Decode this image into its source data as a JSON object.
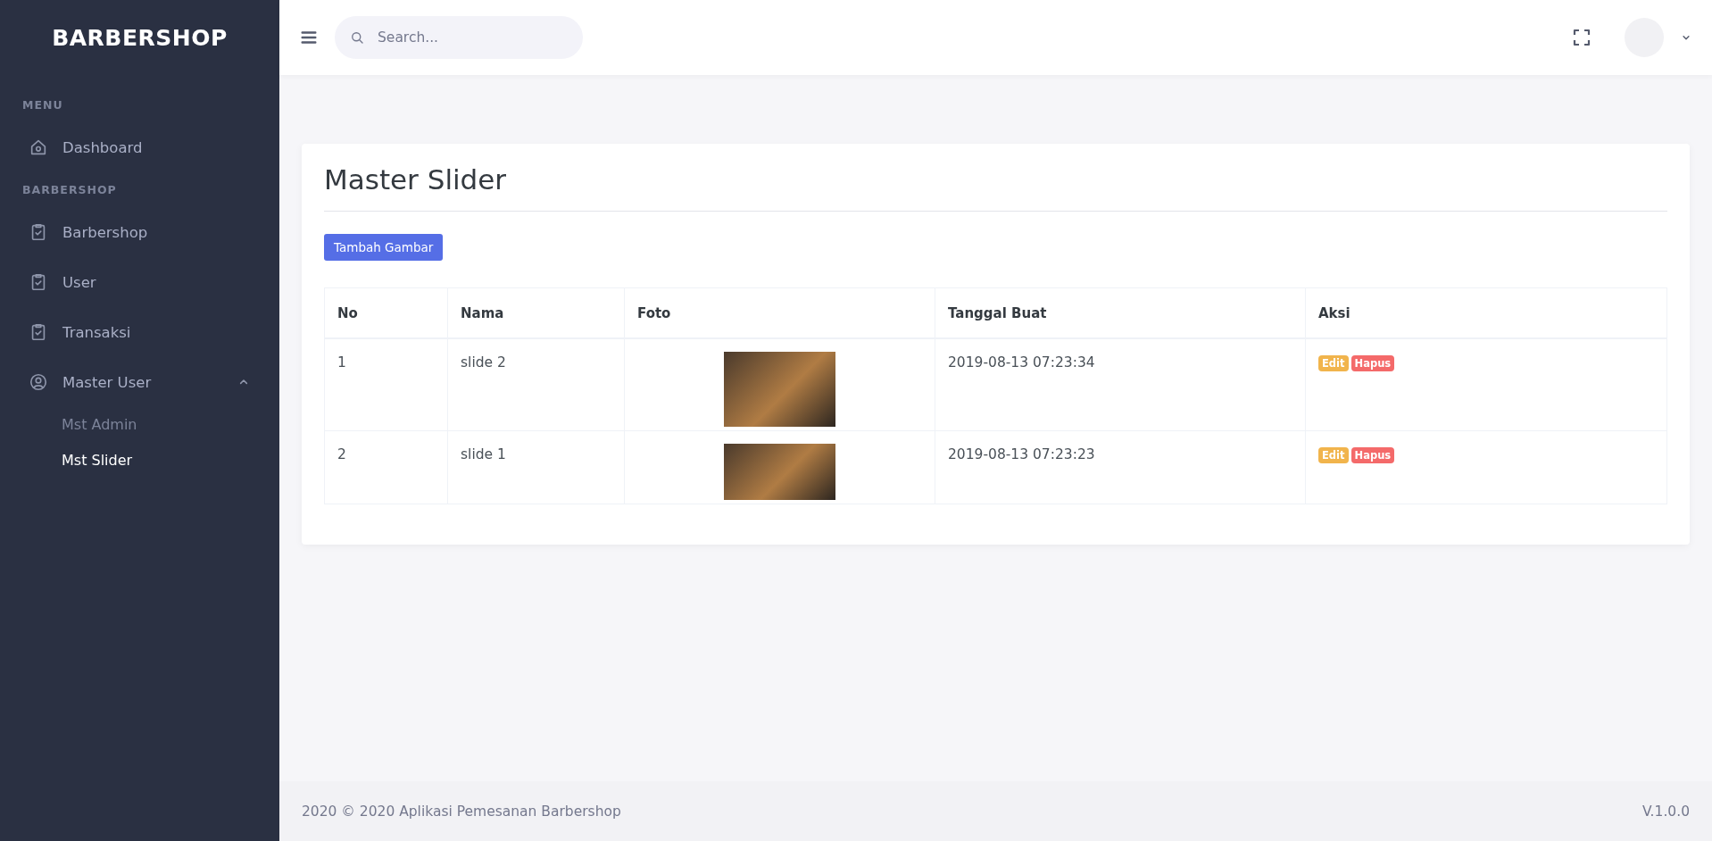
{
  "sidebar": {
    "brand": "BARBERSHOP",
    "sections": [
      {
        "heading": "MENU",
        "items": [
          {
            "kind": "home",
            "label": "Dashboard"
          }
        ]
      },
      {
        "heading": "BARBERSHOP",
        "items": [
          {
            "kind": "clipboard",
            "label": "Barbershop"
          },
          {
            "kind": "clipboard",
            "label": "User"
          },
          {
            "kind": "clipboard",
            "label": "Transaksi"
          },
          {
            "kind": "user",
            "label": "Master User",
            "expanded": true,
            "children": [
              {
                "label": "Mst Admin",
                "selected": false
              },
              {
                "label": "Mst Slider",
                "selected": true
              }
            ]
          }
        ]
      }
    ]
  },
  "header": {
    "search": {
      "placeholder": "Search..."
    }
  },
  "page": {
    "title": "Master Slider",
    "add_button": "Tambah Gambar",
    "table": {
      "columns": [
        "No",
        "Nama",
        "Foto",
        "Tanggal Buat",
        "Aksi"
      ],
      "rows": [
        {
          "no": "1",
          "nama": "slide 2",
          "foto": {
            "kind": "tall"
          },
          "tanggal": "2019-08-13 07:23:34",
          "actions": [
            "Edit",
            "Hapus"
          ]
        },
        {
          "no": "2",
          "nama": "slide 1",
          "foto": {
            "kind": "wide"
          },
          "tanggal": "2019-08-13 07:23:23",
          "actions": [
            "Edit",
            "Hapus"
          ]
        }
      ]
    }
  },
  "footer": {
    "copyright": "2020 © 2020 Aplikasi Pemesanan Barbershop",
    "version": "V.1.0.0"
  }
}
